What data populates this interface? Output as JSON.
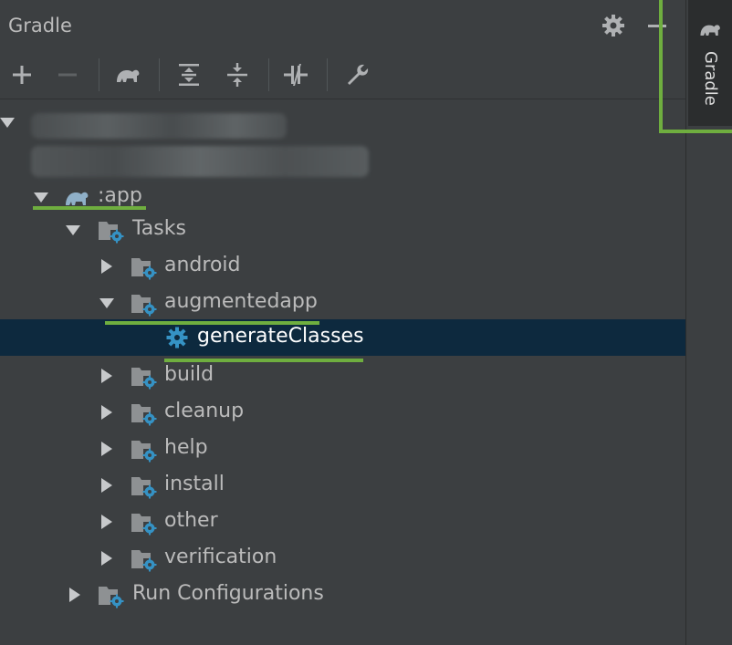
{
  "window": {
    "title": "Gradle"
  },
  "header": {
    "settings_icon": "gear-icon",
    "hide_icon": "minus-icon"
  },
  "toolbar": {
    "icons": [
      "plus-icon",
      "minus-icon",
      "elephant-icon",
      "expand-all-icon",
      "collapse-all-icon",
      "toggle-offline-icon",
      "wrench-icon"
    ]
  },
  "sidebar": {
    "tab_label": "Gradle"
  },
  "tree": {
    "app_label": ":app",
    "tasks_label": "Tasks",
    "groups": {
      "android": "android",
      "augmentedapp": "augmentedapp",
      "build": "build",
      "cleanup": "cleanup",
      "help": "help",
      "install": "install",
      "other": "other",
      "verification": "verification"
    },
    "selected_task": "generateClasses",
    "run_configurations": "Run Configurations"
  },
  "colors": {
    "panel_bg": "#3c3f41",
    "selection_bg": "#0d293e",
    "annotation_green": "#6fae3f",
    "task_icon_blue": "#3592c4"
  }
}
